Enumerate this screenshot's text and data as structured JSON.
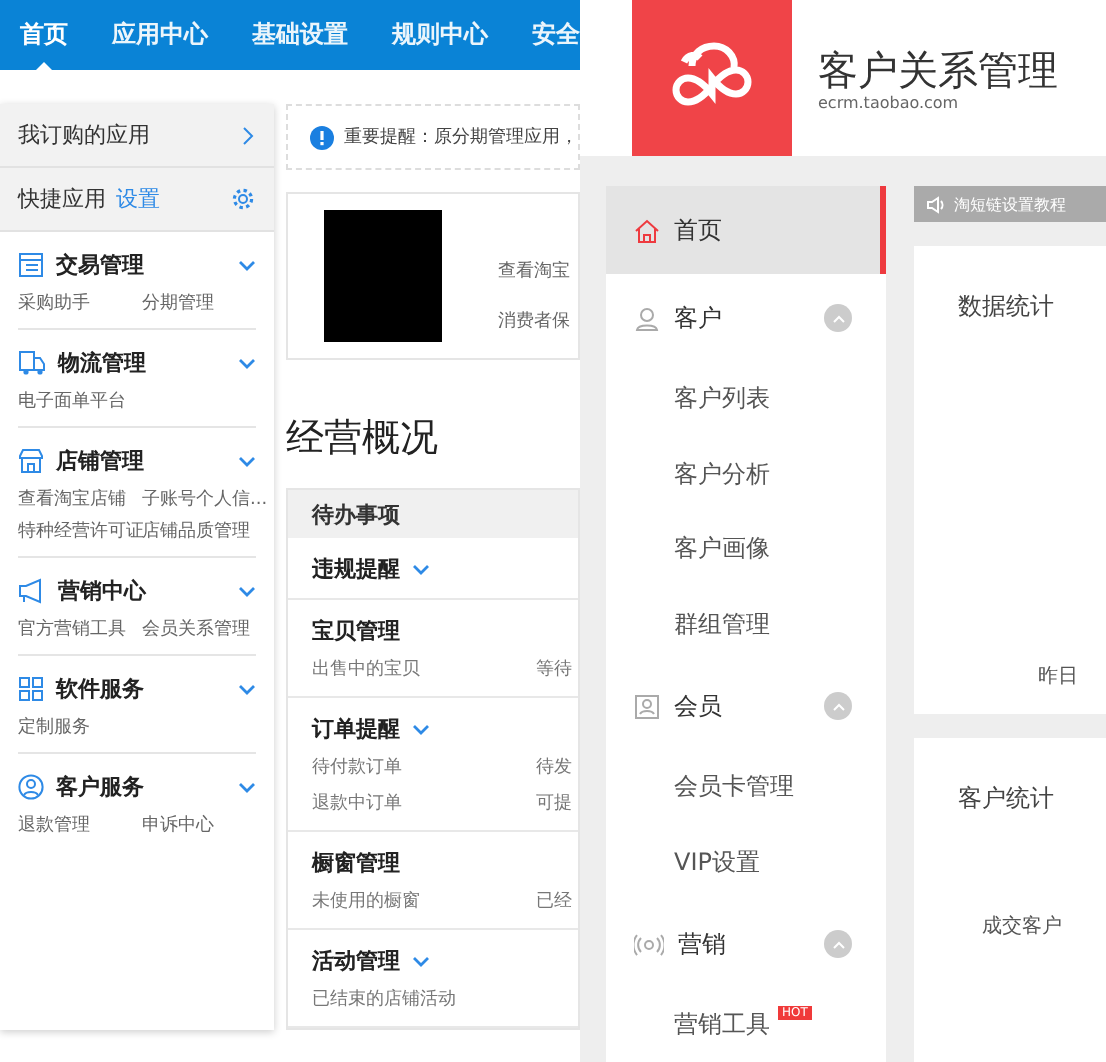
{
  "left_screen": {
    "top_nav": [
      {
        "label": "首页",
        "selected": true
      },
      {
        "label": "应用中心",
        "selected": false
      },
      {
        "label": "基础设置",
        "selected": false
      },
      {
        "label": "规则中心",
        "selected": false
      },
      {
        "label": "安全",
        "selected": false
      }
    ],
    "sidebar": {
      "subscribed_apps": "我订购的应用",
      "quick_apps": {
        "label": "快捷应用",
        "link": "设置"
      },
      "groups": [
        {
          "title": "交易管理",
          "links": [
            "采购助手",
            "分期管理"
          ]
        },
        {
          "title": "物流管理",
          "links": [
            "电子面单平台"
          ]
        },
        {
          "title": "店铺管理",
          "links": [
            "查看淘宝店铺",
            "子账号个人信...",
            "特种经营许可证",
            "店铺品质管理"
          ]
        },
        {
          "title": "营销中心",
          "links": [
            "官方营销工具",
            "会员关系管理"
          ]
        },
        {
          "title": "软件服务",
          "links": [
            "定制服务"
          ]
        },
        {
          "title": "客户服务",
          "links": [
            "退款管理",
            "申诉中心"
          ]
        }
      ]
    },
    "notice": "重要提醒：原分期管理应用，",
    "shop_card": {
      "lines": [
        "查看淘宝",
        "消费者保"
      ]
    },
    "overview_title": "经营概况",
    "todo": {
      "header": "待办事项",
      "sections": [
        {
          "title": "违规提醒",
          "expandable": true
        },
        {
          "title": "宝贝管理",
          "expandable": false,
          "rows": [
            [
              "出售中的宝贝",
              "等待"
            ]
          ]
        },
        {
          "title": "订单提醒",
          "expandable": true,
          "rows": [
            [
              "待付款订单",
              "待发"
            ],
            [
              "退款中订单",
              "可提"
            ]
          ]
        },
        {
          "title": "橱窗管理",
          "expandable": false,
          "rows": [
            [
              "未使用的橱窗",
              "已经"
            ]
          ]
        },
        {
          "title": "活动管理",
          "expandable": true,
          "rows": [
            [
              "已结束的店铺活动"
            ]
          ]
        }
      ]
    }
  },
  "right_screen": {
    "logo_title": "客户关系管理",
    "logo_url": "ecrm.taobao.com",
    "nav": [
      {
        "label": "首页",
        "selected": true
      },
      {
        "label": "客户",
        "selected": false,
        "expanded": true,
        "children": [
          {
            "label": "客户列表"
          },
          {
            "label": "客户分析"
          },
          {
            "label": "客户画像"
          },
          {
            "label": "群组管理"
          }
        ]
      },
      {
        "label": "会员",
        "selected": false,
        "expanded": true,
        "children": [
          {
            "label": "会员卡管理"
          },
          {
            "label": "VIP设置"
          }
        ]
      },
      {
        "label": "营销",
        "selected": false,
        "expanded": true,
        "children": [
          {
            "label": "营销工具",
            "badge": "HOT"
          }
        ]
      }
    ],
    "marquee": "淘短链设置教程",
    "data_stats": {
      "title": "数据统计",
      "caption": "昨日"
    },
    "customer_stats": {
      "title": "客户统计",
      "metric": "成交客户"
    }
  }
}
